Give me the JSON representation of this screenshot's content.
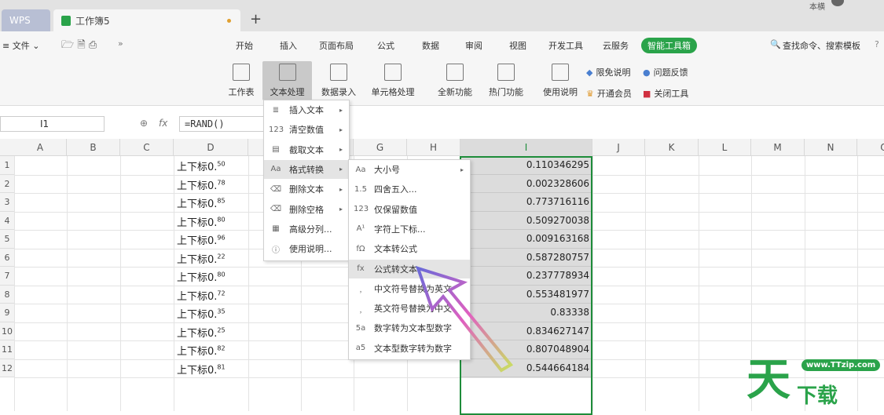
{
  "tabs": {
    "wps": "WPS",
    "workbook": "工作簿5",
    "new_tab": "+"
  },
  "user": {
    "name": "本横"
  },
  "quick": {
    "menu": "≡ 文件 ⌄",
    "more": "»"
  },
  "menu_tabs": [
    "开始",
    "插入",
    "页面布局",
    "公式",
    "数据",
    "审阅",
    "视图",
    "开发工具",
    "云服务",
    "智能工具箱"
  ],
  "search": "查找命令、搜索模板",
  "help": "?",
  "ribbon": {
    "buttons": [
      "工作表",
      "文本处理",
      "数据录入",
      "单元格处理",
      "全新功能",
      "热门功能",
      "使用说明"
    ],
    "small": [
      "限免说明",
      "问题反馈",
      "开通会员",
      "关闭工具"
    ]
  },
  "formula_bar": {
    "cell": "I1",
    "fx": "fx",
    "formula": "=RAND()"
  },
  "columns": [
    "A",
    "B",
    "C",
    "D",
    "E",
    "F",
    "G",
    "H",
    "I",
    "J",
    "K",
    "L",
    "M",
    "N",
    "O"
  ],
  "rows": [
    "1",
    "2",
    "3",
    "4",
    "5",
    "6",
    "7",
    "8",
    "9",
    "10",
    "11",
    "12"
  ],
  "col_d": {
    "text": "上下标",
    "values": [
      "0.",
      "0.",
      "0.",
      "0.",
      "0.",
      "0.",
      "0.",
      "0.",
      "0.",
      "0.",
      "0.",
      "0."
    ],
    "sup": [
      "50",
      "78",
      "85",
      "80",
      "96",
      "22",
      "80",
      "72",
      "35",
      "25",
      "82",
      "81"
    ]
  },
  "col_i": [
    "0.110346295",
    "0.002328606",
    "0.773716116",
    "0.509270038",
    "0.009163168",
    "0.587280757",
    "0.237778934",
    "0.553481977",
    "0.83338",
    "0.834627147",
    "0.807048904",
    "0.544664184"
  ],
  "menu1": [
    {
      "icon": "≣",
      "label": "插入文本"
    },
    {
      "icon": "123",
      "label": "清空数值"
    },
    {
      "icon": "▤",
      "label": "截取文本"
    },
    {
      "icon": "Aa",
      "label": "格式转换"
    },
    {
      "icon": "⌫",
      "label": "删除文本"
    },
    {
      "icon": "⌫",
      "label": "删除空格"
    },
    {
      "icon": "▦",
      "label": "高级分列..."
    },
    {
      "icon": "ⓘ",
      "label": "使用说明..."
    }
  ],
  "menu2": [
    {
      "icon": "Aa",
      "label": "大小号"
    },
    {
      "icon": "1.5",
      "label": "四舍五入..."
    },
    {
      "icon": "123",
      "label": "仅保留数值"
    },
    {
      "icon": "A¹",
      "label": "字符上下标..."
    },
    {
      "icon": "fΩ",
      "label": "文本转公式"
    },
    {
      "icon": "fx",
      "label": "公式转文本"
    },
    {
      "icon": "﹐",
      "label": "中文符号替换为英文"
    },
    {
      "icon": "﹐",
      "label": "英文符号替换为中文"
    },
    {
      "icon": "5a",
      "label": "数字转为文本型数字"
    },
    {
      "icon": "a5",
      "label": "文本型数字转为数字"
    }
  ],
  "watermark": {
    "url": "www.TTzip.com",
    "logo": "天下载"
  },
  "colors": {
    "accent": "#2aa34a",
    "selection": "#1e8c3a"
  }
}
